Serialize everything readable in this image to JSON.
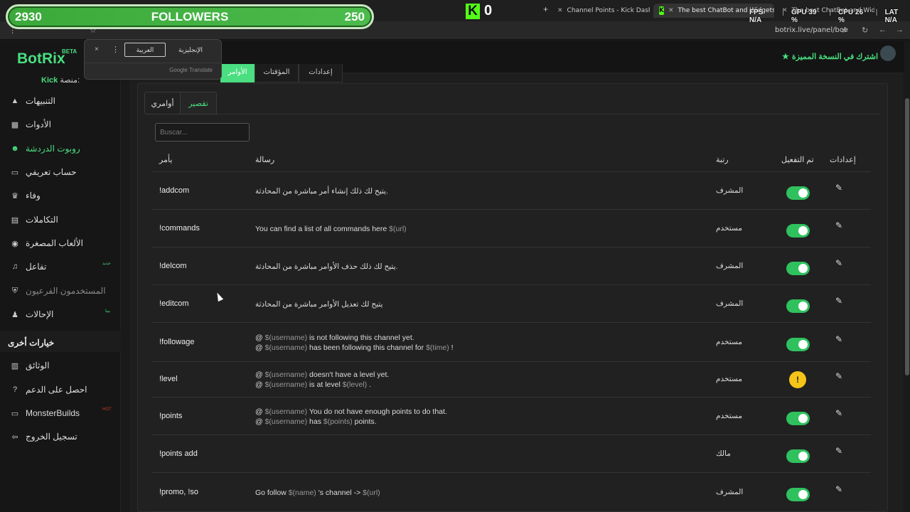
{
  "browser": {
    "tabs": [
      {
        "label": "Channel Points - Kick Dashboar"
      },
      {
        "label": "The best ChatBot and Widgets"
      },
      {
        "label": "The best ChatBot and Widgets"
      }
    ],
    "new_tab": "+",
    "url": "botrix.live/panel/bot"
  },
  "overlay": {
    "followers_left": "2930",
    "followers_title": "FOLLOWERS",
    "followers_right": "250",
    "kick_logo": "K",
    "kick_count": "0",
    "stats": {
      "fps_label": "FPS",
      "fps_value": "N/A",
      "gpu_label": "GPU",
      "gpu_value": "39 %",
      "cpu_label": "CPU",
      "cpu_value": "26 %",
      "lat_label": "LAT",
      "lat_value": "N/A"
    }
  },
  "translate_popup": {
    "close": "×",
    "menu": "⋮",
    "selected_lang": "العربية",
    "other_lang": "الإنجليزية",
    "brand": "Google Translate"
  },
  "app": {
    "logo": "BotRix",
    "beta": "BETA",
    "platform_label": "منصة:",
    "platform_value": "Kick",
    "premium_text": "اشترك في النسخة المميزة",
    "nav": [
      {
        "label": "التنبيهات",
        "icon": "warning-icon"
      },
      {
        "label": "الأدوات",
        "icon": "grid-icon"
      },
      {
        "label": "روبوت الدردشة",
        "icon": "robot-icon"
      },
      {
        "label": "حساب تعريفي",
        "icon": "id-card-icon"
      },
      {
        "label": "وفاء",
        "icon": "trophy-icon"
      },
      {
        "label": "التكاملات",
        "icon": "doc-icon"
      },
      {
        "label": "الألعاب المصغرة",
        "icon": "gamepad-icon"
      },
      {
        "label": "تفاعل",
        "icon": "music-icon"
      },
      {
        "label": "المستخدمون الفرعيون",
        "icon": "shield-icon"
      },
      {
        "label": "الإحالات",
        "icon": "users-icon"
      }
    ],
    "nav_tags": {
      "new": "جديد",
      "beta": "بيتا",
      "hot": "HOT"
    },
    "other_options_title": "خيارات أخرى",
    "other_nav": [
      {
        "label": "الوثائق",
        "icon": "book-icon"
      },
      {
        "label": "احصل على الدعم",
        "icon": "help-icon"
      },
      {
        "label": "MonsterBuilds",
        "icon": "laptop-icon"
      },
      {
        "label": "تسجيل الخروج",
        "icon": "logout-icon"
      }
    ]
  },
  "main": {
    "top_tabs": [
      "الأوامر",
      "المؤقتات",
      "إعدادات"
    ],
    "sub_tabs": [
      "أوامري",
      "تقصير"
    ],
    "search_placeholder": "Buscar...",
    "columns": {
      "command": "يأمر",
      "message": "رسالة",
      "rank": "رتبة",
      "enabled": "تم التفعيل",
      "settings": "إعدادات"
    },
    "rows": [
      {
        "command": "!addcom",
        "line1": "يتيح لك ذلك إنشاء أمر مباشرة من المحادثة.",
        "line2": "",
        "rank": "المشرف",
        "status": "on"
      },
      {
        "command": "!commands",
        "line1": "You can find a list of all commands here  $(url)",
        "line2": "",
        "rank": "مستخدم",
        "status": "on"
      },
      {
        "command": "!delcom",
        "line1": "يتيح لك ذلك حذف الأوامر مباشرة من المحادثة.",
        "line2": "",
        "rank": "المشرف",
        "status": "on"
      },
      {
        "command": "!editcom",
        "line1": "يتيح لك تعديل الأوامر مباشرة من المحادثة",
        "line2": "",
        "rank": "المشرف",
        "status": "on"
      },
      {
        "command": "!followage",
        "line1": "@ $(username)  is not following this channel yet.",
        "line2": "@ $(username)  has been following this channel for  $(time)  !",
        "rank": "مستخدم",
        "status": "on"
      },
      {
        "command": "!level",
        "line1": "@ $(username)  doesn't have a level yet.",
        "line2": "@ $(username)  is at level  $(level)  .",
        "rank": "مستخدم",
        "status": "warning"
      },
      {
        "command": "!points",
        "line1": "@ $(username)  You do not have enough points to do that.",
        "line2": "@ $(username)  has  $(points)  points.",
        "rank": "مستخدم",
        "status": "on"
      },
      {
        "command": "!points add",
        "line1": "",
        "line2": "",
        "rank": "مالك",
        "status": "on"
      },
      {
        "command": "!promo, !so",
        "line1": "Go follow  $(name)  's channel ->  $(url)",
        "line2": "",
        "rank": "المشرف",
        "status": "on"
      }
    ],
    "edit_icon": "✎",
    "warning_icon": "!"
  }
}
